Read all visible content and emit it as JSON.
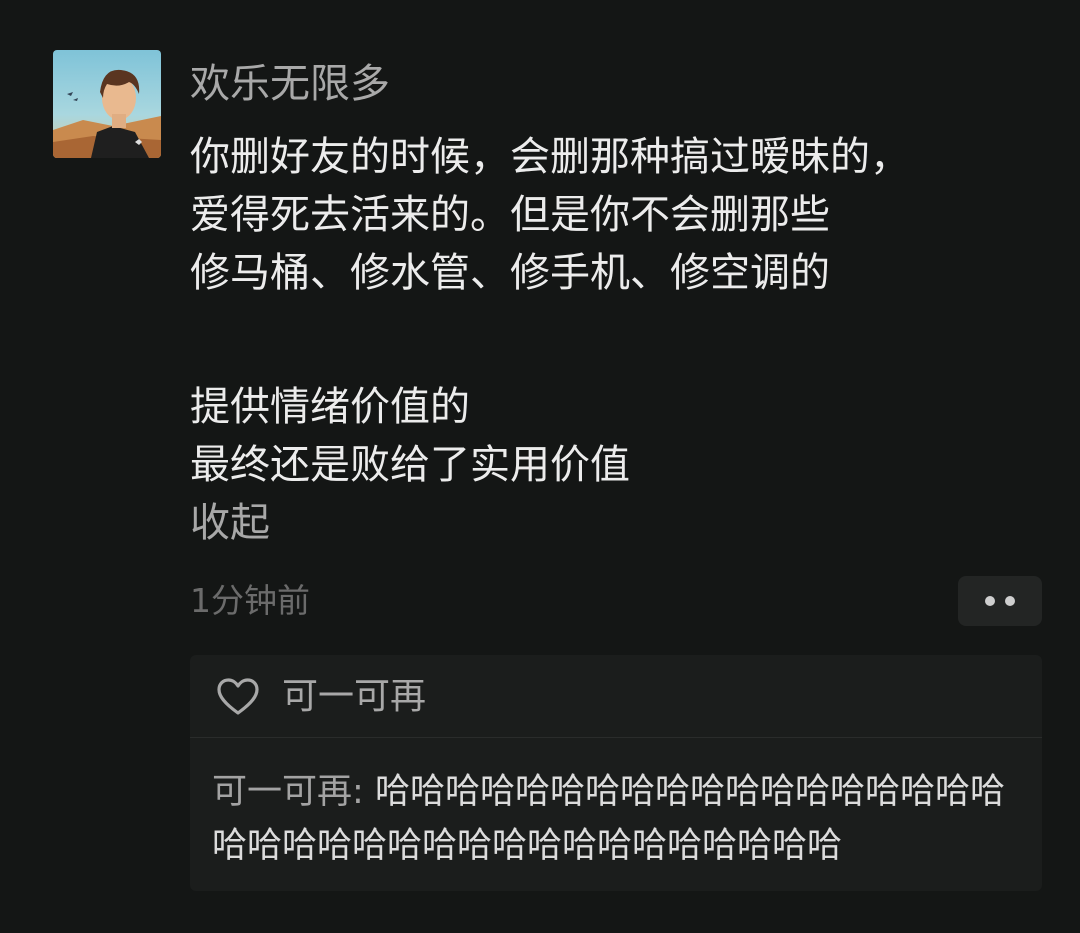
{
  "post": {
    "author": "欢乐无限多",
    "paragraphs": [
      [
        "你删好友的时候，会删那种搞过暧昧的，",
        "爱得死去活来的。但是你不会删那些",
        "修马桶、修水管、修手机、修空调的"
      ],
      [
        "提供情绪价值的",
        "最终还是败给了实用价值"
      ]
    ],
    "collapse_label": "收起",
    "timestamp": "1分钟前"
  },
  "icons": {
    "more": "more-dots-icon",
    "like": "heart-outline-icon"
  },
  "likes": {
    "users": "可一可再"
  },
  "comment": {
    "author": "可一可再",
    "separator": ": ",
    "text": "哈哈哈哈哈哈哈哈哈哈哈哈哈哈哈哈哈哈哈哈哈哈哈哈哈哈哈哈哈哈哈哈哈哈哈哈"
  },
  "colors": {
    "background": "#141615",
    "panel": "#1b1d1c",
    "primary_text": "#ececec",
    "secondary_text": "#a9a9a9",
    "muted_text": "#6b6b6b"
  }
}
